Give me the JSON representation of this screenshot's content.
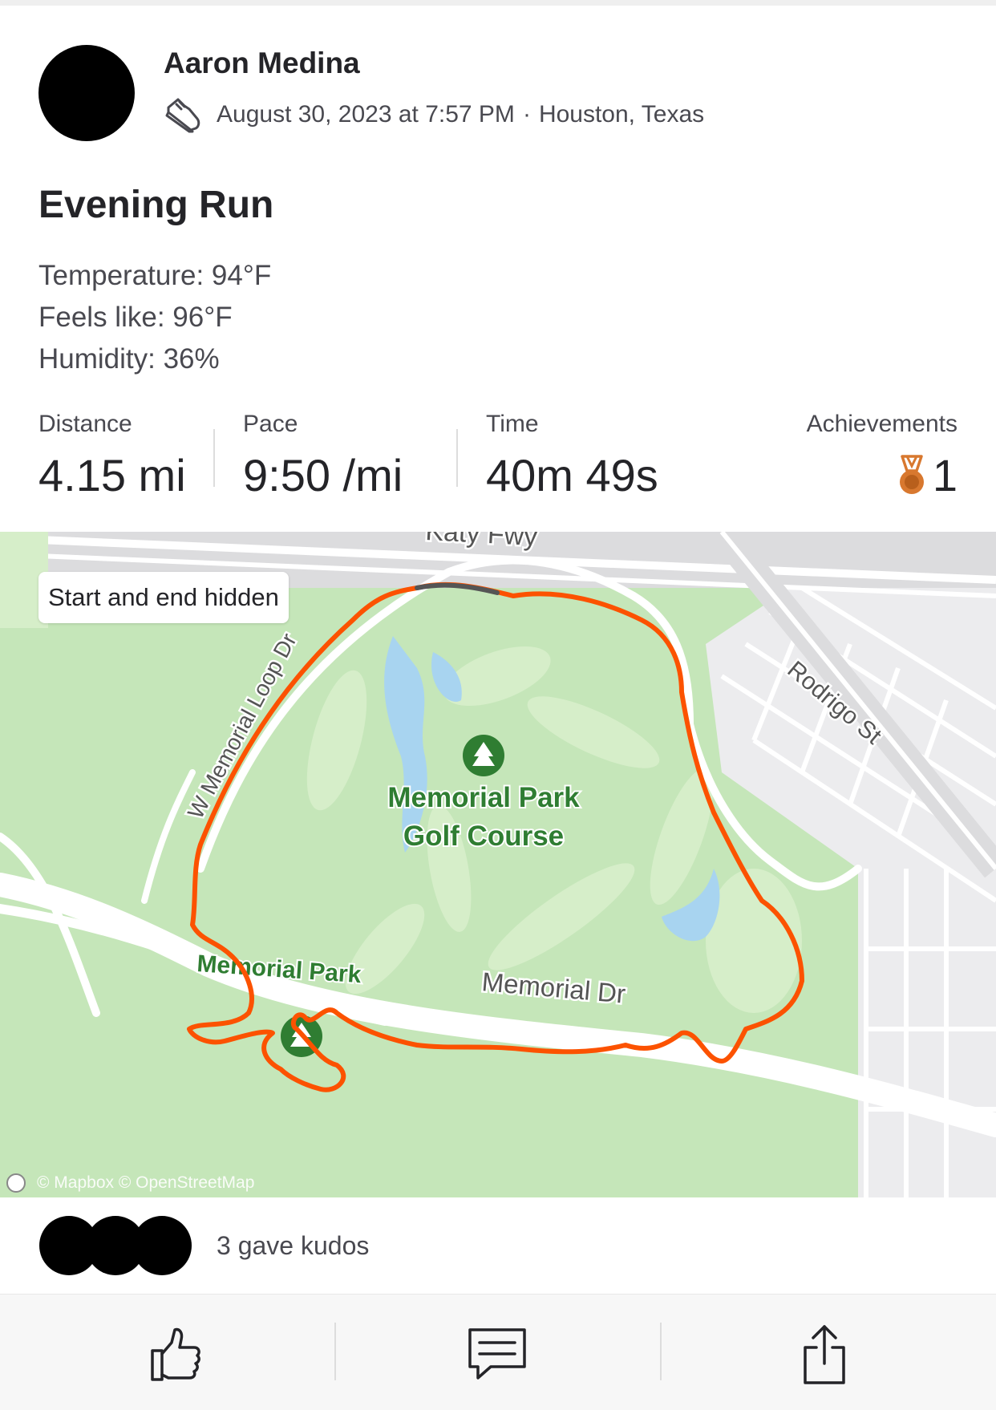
{
  "athlete": {
    "name": "Aaron Medina"
  },
  "activity": {
    "date": "August 30, 2023 at 7:57 PM",
    "separator": "·",
    "location": "Houston, Texas",
    "sport_icon": "running-shoe-icon",
    "title": "Evening Run",
    "description": [
      "Temperature: 94°F",
      "Feels like: 96°F",
      "Humidity: 36%"
    ]
  },
  "stats": {
    "distance": {
      "label": "Distance",
      "value": "4.15 mi"
    },
    "pace": {
      "label": "Pace",
      "value": "9:50 /mi"
    },
    "time": {
      "label": "Time",
      "value": "40m 49s"
    },
    "achievements": {
      "label": "Achievements",
      "value": "1",
      "icon": "bronze-medal-icon"
    }
  },
  "map": {
    "privacy_label": "Start and end hidden",
    "attribution": "© Mapbox © OpenStreetMap",
    "places": {
      "park": [
        "Memorial Park",
        "Golf Course"
      ],
      "road_memorial_dr": "Memorial Dr",
      "road_loop": "W Memorial Loop Dr",
      "road_rodrigo": "Rodrigo St",
      "road_katy": "Katy Fwy",
      "road_park": "Memorial Park"
    },
    "colors": {
      "route": "#fc5200",
      "park": "#c5e6b9",
      "water": "#a8d4f0",
      "road": "#ffffff"
    }
  },
  "kudos": {
    "text": "3 gave kudos"
  },
  "actions": {
    "kudos": "thumbs-up-icon",
    "comment": "comment-icon",
    "share": "share-icon"
  }
}
